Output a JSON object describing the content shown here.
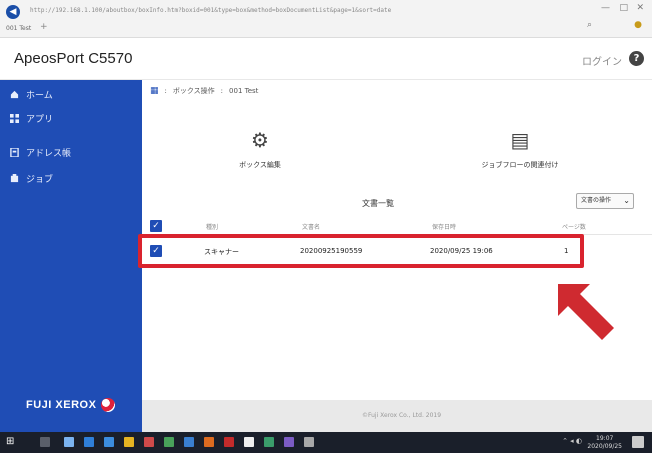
{
  "browser": {
    "url": "http://192.168.1.100/aboutbox/boxInfo.htm?boxid=001&type=box&method=boxDocumentList&page=1&sort=date",
    "tab_label": "001 Test",
    "tab_plus": "+",
    "window_controls": [
      "—",
      "□",
      "✕"
    ]
  },
  "app": {
    "title": "ApeosPort C5570",
    "login_label": "ログイン",
    "help_label": "?"
  },
  "sidebar": {
    "items": [
      {
        "label": "ホーム",
        "icon": "home-icon"
      },
      {
        "label": "アプリ",
        "icon": "apps-icon"
      },
      {
        "label": "アドレス帳",
        "icon": "address-book-icon"
      },
      {
        "label": "ジョブ",
        "icon": "job-icon"
      }
    ],
    "brand": "FUJI XEROX"
  },
  "breadcrumb": {
    "items": [
      "ボックス操作",
      "001 Test"
    ]
  },
  "actions": {
    "box_edit_label": "ボックス編集",
    "job_flow_label": "ジョブフローの関連付け"
  },
  "document_list": {
    "title": "文書一覧",
    "sort_label": "文書の操作",
    "columns": [
      "種別",
      "文書名",
      "保存日時",
      "ページ数"
    ],
    "rows": [
      {
        "type": "スキャナー",
        "name": "20200925190559",
        "date": "2020/09/25 19:06",
        "pages": "1"
      }
    ]
  },
  "footer": {
    "text": "©Fuji Xerox Co., Ltd. 2019"
  },
  "colors": {
    "sidebar_blue": "#1f4db5",
    "highlight_red": "#d9232e",
    "arrow_red": "#cf2a30"
  }
}
